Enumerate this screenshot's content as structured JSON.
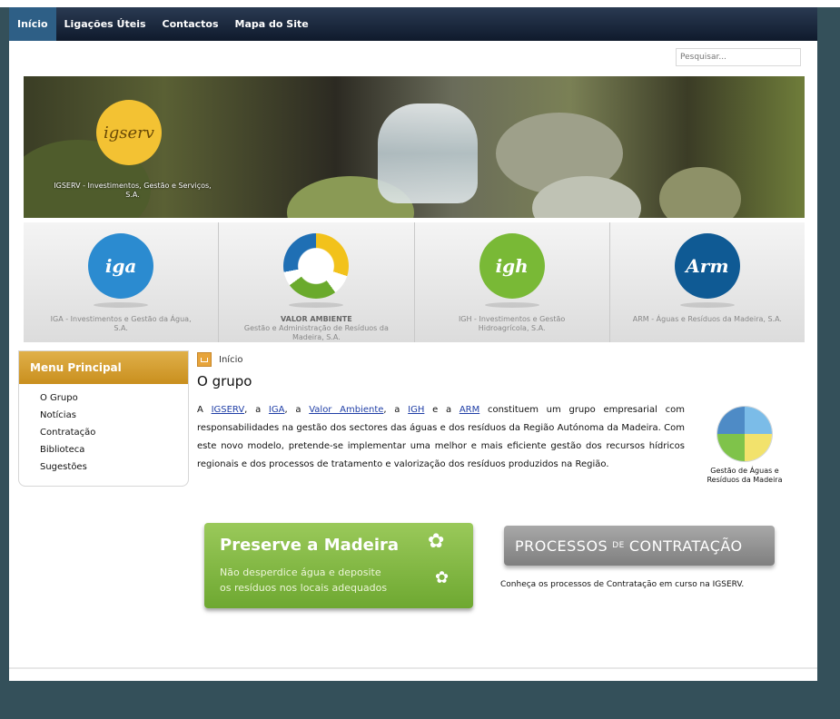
{
  "nav": {
    "items": [
      "Início",
      "Ligações Úteis",
      "Contactos",
      "Mapa do Site"
    ]
  },
  "search": {
    "placeholder": "Pesquisar..."
  },
  "hero": {
    "logo_text": "igserv",
    "caption": "IGSERV - Investimentos, Gestão e Serviços, S.A."
  },
  "partners": [
    {
      "logo": "iga",
      "color": "#2b8bd0",
      "heading": "",
      "name": "IGA - Investimentos e Gestão da Água, S.A."
    },
    {
      "logo": "",
      "color": "#ffffff",
      "heading": "VALOR AMBIENTE",
      "name": "Gestão e Administração de Resíduos da Madeira, S.A."
    },
    {
      "logo": "igh",
      "color": "#79b936",
      "heading": "",
      "name": "IGH - Investimentos e Gestão Hidroagrícola, S.A."
    },
    {
      "logo": "Arm",
      "color": "#0f5a94",
      "heading": "",
      "name": "ARM - Águas e Resíduos da Madeira, S.A."
    }
  ],
  "sidebar": {
    "title": "Menu Principal",
    "items": [
      "O Grupo",
      "Notícias",
      "Contratação",
      "Biblioteca",
      "Sugestões"
    ]
  },
  "breadcrumb": {
    "label": "Início"
  },
  "main": {
    "title": "O grupo",
    "links": [
      "IGSERV",
      "IGA",
      "Valor Ambiente",
      "IGH",
      "ARM"
    ],
    "intro_prefix": "A",
    "sep": ", a",
    "and": "e a",
    "intro_rest": "constituem um grupo empresarial com responsabilidades na gestão dos sectores das águas e dos resíduos da Região Autónoma da Madeira. Com este novo modelo, pretende-se implementar uma melhor e mais eficiente gestão dos recursos hídricos regionais e dos processos de tratamento e valorização dos resíduos produzidos na Região."
  },
  "gadm": {
    "caption_line1": "Gestão de Águas e",
    "caption_line2": "Resíduos da Madeira"
  },
  "banners": {
    "preserve_title": "Preserve a Madeira",
    "preserve_line1": "Não desperdice  água e  deposite",
    "preserve_line2": "os resíduos nos locais adequados",
    "proc_part1": "PROCESSOS",
    "proc_part2": "DE",
    "proc_part3": "CONTRATAÇÃO",
    "proc_text": "Conheça os processos de Contratação em curso na IGSERV."
  },
  "colors": {
    "accent_nav": "#2e5f86",
    "menu_header": "#d9a23a",
    "link": "#1f3ea6",
    "green_banner": "#7fb843"
  },
  "icons": {
    "home": "home-icon",
    "flower": "flower-icon"
  }
}
